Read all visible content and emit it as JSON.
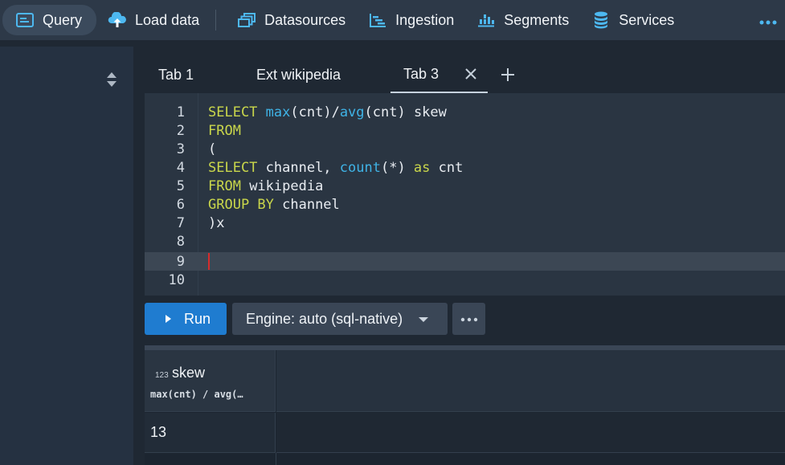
{
  "nav": {
    "items": [
      {
        "label": "Query",
        "icon": "query-console-icon"
      },
      {
        "label": "Load data",
        "icon": "cloud-upload-icon"
      },
      {
        "label": "Datasources",
        "icon": "multi-select-icon"
      },
      {
        "label": "Ingestion",
        "icon": "gantt-chart-icon"
      },
      {
        "label": "Segments",
        "icon": "stacked-chart-icon"
      },
      {
        "label": "Services",
        "icon": "database-icon"
      }
    ],
    "more_icon": "more-icon"
  },
  "tabs": {
    "items": [
      "Tab 1",
      "Ext wikipedia",
      "Tab 3"
    ],
    "active": "Tab 3"
  },
  "editor": {
    "line_numbers": [
      "1",
      "2",
      "3",
      "4",
      "5",
      "6",
      "7",
      "8",
      "9",
      "10"
    ],
    "current_line": "9"
  },
  "toolbar": {
    "run_label": "Run",
    "engine_label": "Engine: auto (sql-native)"
  },
  "results": {
    "column": {
      "type_label": "123",
      "name": "skew",
      "expression": "max(cnt) / avg(…"
    },
    "rows": [
      [
        "13"
      ]
    ]
  },
  "colors": {
    "accent": "#1f7cd0",
    "keyword": "#c9d64b",
    "function": "#3fb3e6",
    "cursor": "#d62c2c"
  }
}
